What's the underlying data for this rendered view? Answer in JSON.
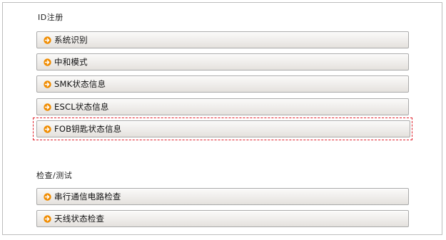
{
  "sections": [
    {
      "title": "ID注册",
      "items": [
        {
          "label": "系统识别",
          "icon": "orange-arrow-circle-icon"
        },
        {
          "label": "中和模式",
          "icon": "orange-arrow-circle-icon"
        },
        {
          "label": "SMK状态信息",
          "icon": "orange-arrow-circle-icon"
        },
        {
          "label": "ESCL状态信息",
          "icon": "orange-arrow-circle-icon"
        },
        {
          "label": "FOB钥匙状态信息",
          "icon": "orange-arrow-circle-icon"
        }
      ]
    },
    {
      "title": "检查/测试",
      "items": [
        {
          "label": "串行通信电路检查",
          "icon": "orange-arrow-circle-icon"
        },
        {
          "label": "天线状态检查",
          "icon": "orange-arrow-circle-icon"
        }
      ]
    }
  ],
  "colors": {
    "icon_orange": "#f08c00",
    "highlight_dashed_border": "#e0202a",
    "panel_border": "#bdbdbd"
  }
}
